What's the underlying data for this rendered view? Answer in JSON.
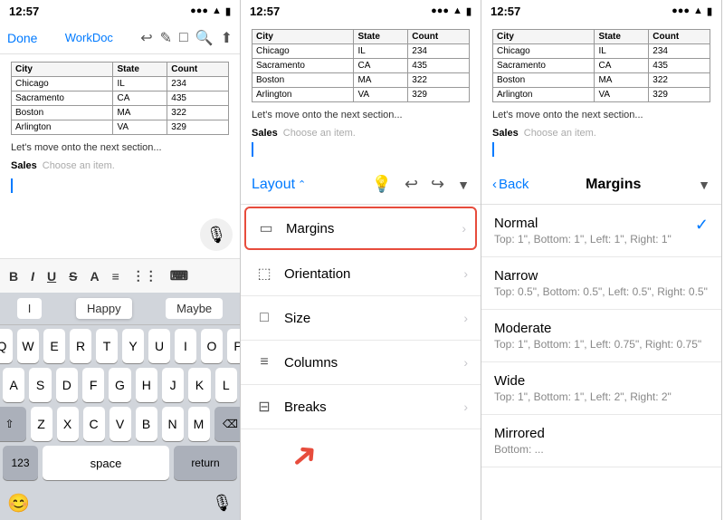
{
  "status": {
    "time": "12:57",
    "signal": "●●●",
    "wifi": "▲",
    "battery": "▮"
  },
  "panel1": {
    "app_title": "WorkDoc",
    "done_label": "Done",
    "toolbar_icons": [
      "↩",
      "✏",
      "□",
      "🔍",
      "⬆"
    ],
    "table": {
      "headers": [
        "City",
        "State",
        "Count"
      ],
      "rows": [
        [
          "Chicago",
          "IL",
          "234"
        ],
        [
          "Sacramento",
          "CA",
          "435"
        ],
        [
          "Boston",
          "MA",
          "322"
        ],
        [
          "Arlington",
          "VA",
          "329"
        ]
      ]
    },
    "doc_text": "Let's move onto the next section...",
    "sales_label": "Sales",
    "sales_placeholder": "Choose an item.",
    "format_buttons": [
      "B",
      "I",
      "U",
      "S",
      "A",
      "≡",
      "⋮⋮⋮",
      "⌨"
    ],
    "keyboard": {
      "suggestions": [
        "I",
        "Happy",
        "Maybe"
      ],
      "rows": [
        [
          "Q",
          "W",
          "E",
          "R",
          "T",
          "Y",
          "U",
          "I",
          "O",
          "P"
        ],
        [
          "A",
          "S",
          "D",
          "F",
          "G",
          "H",
          "J",
          "K",
          "L"
        ],
        [
          "↑",
          "Z",
          "X",
          "C",
          "V",
          "B",
          "N",
          "M",
          "⌫"
        ],
        [
          "123",
          "space",
          "return"
        ]
      ],
      "space_label": "space",
      "return_label": "return",
      "num_label": "123"
    }
  },
  "panel2": {
    "layout_label": "Layout",
    "toolbar_icons": [
      "💡",
      "↩",
      "↪",
      "▼"
    ],
    "menu_items": [
      {
        "icon": "▭",
        "label": "Margins",
        "chevron": "›"
      },
      {
        "icon": "⬚",
        "label": "Orientation",
        "chevron": "›"
      },
      {
        "icon": "□",
        "label": "Size",
        "chevron": "›"
      },
      {
        "icon": "≡",
        "label": "Columns",
        "chevron": "›"
      },
      {
        "icon": "⊟",
        "label": "Breaks",
        "chevron": "›"
      }
    ],
    "table": {
      "headers": [
        "City",
        "State",
        "Count"
      ],
      "rows": [
        [
          "Chicago",
          "IL",
          "234"
        ],
        [
          "Sacramento",
          "CA",
          "435"
        ],
        [
          "Boston",
          "MA",
          "322"
        ],
        [
          "Arlington",
          "VA",
          "329"
        ]
      ]
    },
    "doc_text": "Let's move onto the next section...",
    "sales_label": "Sales",
    "sales_placeholder": "Choose an item."
  },
  "panel3": {
    "back_label": "Back",
    "title": "Margins",
    "margins": [
      {
        "name": "Normal",
        "desc": "Top: 1\", Bottom: 1\", Left: 1\", Right: 1\"",
        "selected": true
      },
      {
        "name": "Narrow",
        "desc": "Top: 0.5\", Bottom: 0.5\", Left: 0.5\", Right: 0.5\"",
        "selected": false
      },
      {
        "name": "Moderate",
        "desc": "Top: 1\", Bottom: 1\", Left: 0.75\", Right: 0.75\"",
        "selected": false
      },
      {
        "name": "Wide",
        "desc": "Top: 1\", Bottom: 1\", Left: 2\", Right: 2\"",
        "selected": false
      },
      {
        "name": "Mirrored",
        "desc": "Bottom: ...",
        "selected": false
      }
    ],
    "table": {
      "headers": [
        "City",
        "State",
        "Count"
      ],
      "rows": [
        [
          "Chicago",
          "IL",
          "234"
        ],
        [
          "Sacramento",
          "CA",
          "435"
        ],
        [
          "Boston",
          "MA",
          "322"
        ],
        [
          "Arlington",
          "VA",
          "329"
        ]
      ]
    },
    "doc_text": "Let's move onto the next section...",
    "sales_label": "Sales",
    "sales_placeholder": "Choose an item."
  }
}
